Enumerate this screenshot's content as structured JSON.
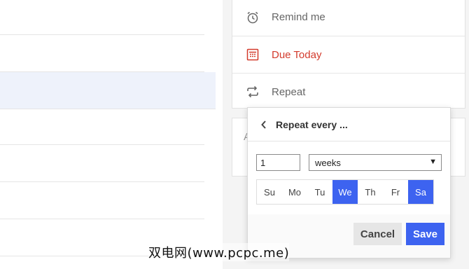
{
  "details": {
    "remind_label": "Remind me",
    "due_label": "Due Today",
    "repeat_label": "Repeat",
    "peek_text": "A"
  },
  "repeat_popover": {
    "title": "Repeat every ...",
    "interval_value": "1",
    "unit_selected": "weeks",
    "days": [
      {
        "label": "Su",
        "selected": false
      },
      {
        "label": "Mo",
        "selected": false
      },
      {
        "label": "Tu",
        "selected": false
      },
      {
        "label": "We",
        "selected": true
      },
      {
        "label": "Th",
        "selected": false
      },
      {
        "label": "Fr",
        "selected": false
      },
      {
        "label": "Sa",
        "selected": true
      }
    ],
    "cancel_label": "Cancel",
    "save_label": "Save"
  },
  "colors": {
    "accent": "#3d63f0",
    "due": "#d33a2c"
  },
  "watermark": "双电网(www.pcpc.me)"
}
